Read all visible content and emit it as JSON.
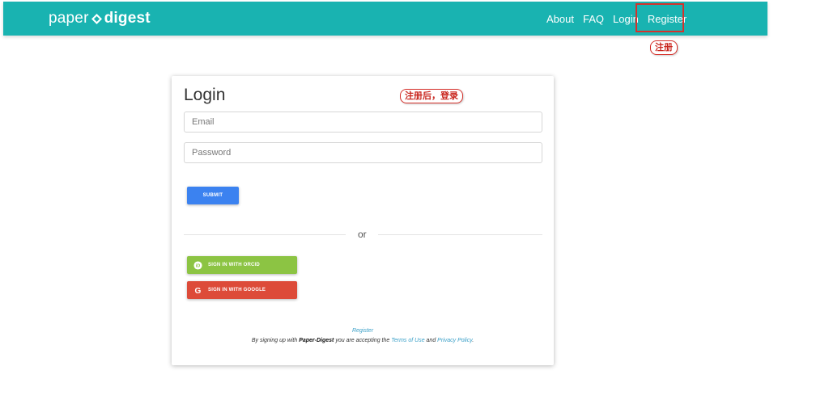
{
  "navbar": {
    "logo_left": "paper",
    "logo_right": "digest",
    "links": [
      "About",
      "FAQ",
      "Login",
      "Register"
    ]
  },
  "annotations": {
    "register_note": "注册",
    "login_note": "注册后，登录"
  },
  "login": {
    "title": "Login",
    "email_placeholder": "Email",
    "password_placeholder": "Password",
    "submit_label": "SUBMIT",
    "or_label": "or",
    "orcid_label": "SIGN IN WITH ORCID",
    "google_label": "SIGN IN WITH GOOGLE",
    "register_link": "Register",
    "footer": {
      "pre": "By signing up with ",
      "brand": "Paper-Digest",
      "mid": " you are accepting the ",
      "terms": "Terms of Use",
      "and": " and ",
      "privacy": "Privacy Policy",
      "end": "."
    }
  },
  "colors": {
    "navbar": "#19b3b1",
    "submit": "#3b82f0",
    "orcid": "#8cc443",
    "google": "#dd4b39",
    "highlight": "#d6312b"
  }
}
